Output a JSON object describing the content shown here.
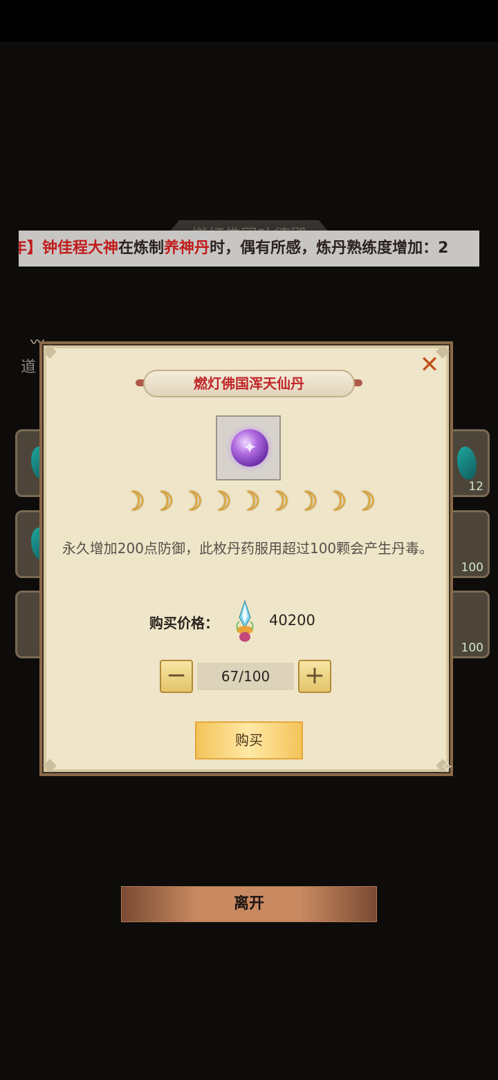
{
  "background": {
    "hall_title": "燃灯佛国功德殿",
    "side_label": "道",
    "slot_counts": [
      "12",
      "100",
      "100"
    ]
  },
  "marquee": {
    "prefix": "年】",
    "player": "钟佳程大神",
    "mid1": "在炼制",
    "item": "养神丹",
    "mid2": "时，偶有所感，炼丹熟练度增加：2"
  },
  "dialog": {
    "title": "燃灯佛国浑天仙丹",
    "close_icon": "close-icon",
    "item_icon": "purple-orb-icon",
    "moon_icon": "crescent-moon-icon",
    "moon_count": 9,
    "description": "永久增加200点防御，此枚丹药服用超过100颗会产生丹毒。",
    "price_label": "购买价格：",
    "price_icon": "crystal-currency-icon",
    "price_value": "40200",
    "quantity": "67/100",
    "buy_label": "购买"
  },
  "leave_label": "离开",
  "colors": {
    "title_red": "#c0262a",
    "moon_gold": "#e8a41a",
    "dialog_bg": "#efe5c8"
  }
}
